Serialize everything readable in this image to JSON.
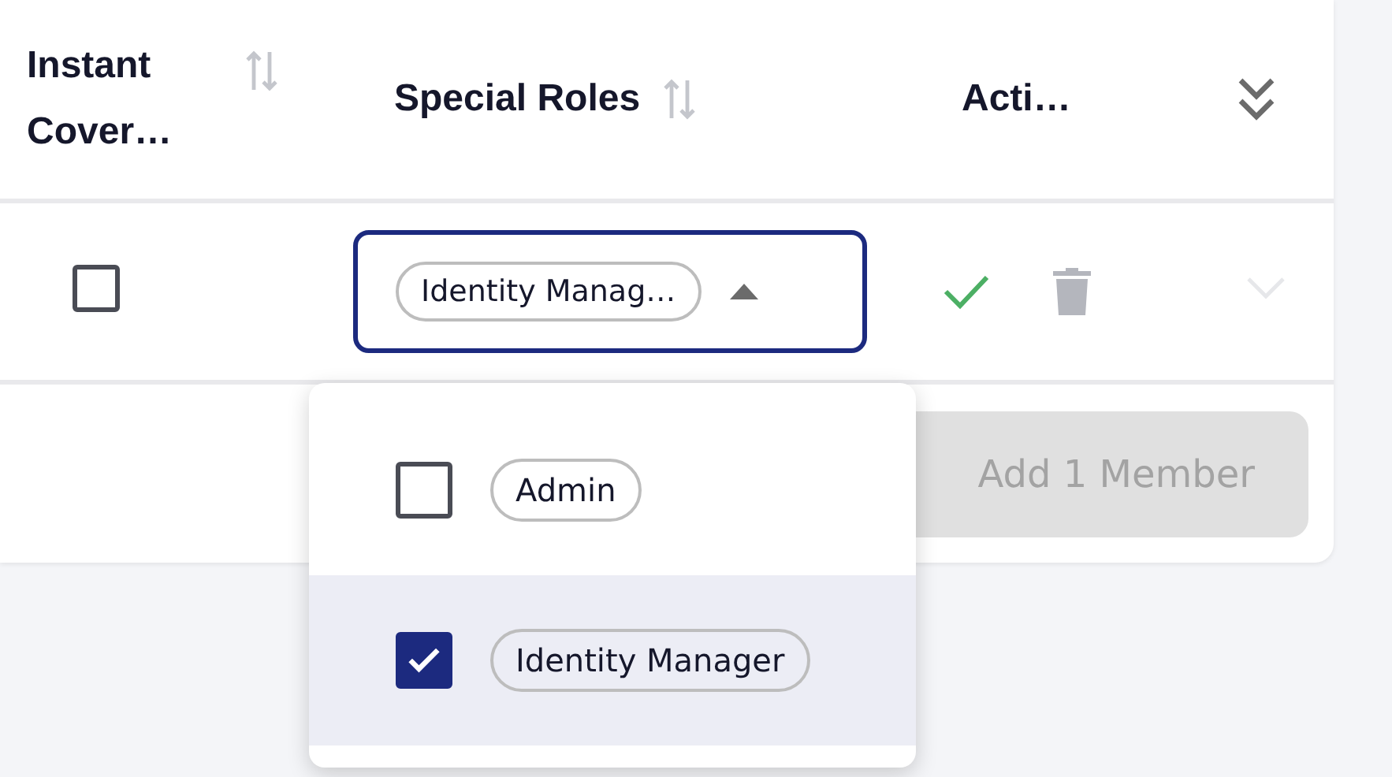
{
  "table": {
    "columns": [
      {
        "label": "Instant Cover…",
        "sortable": true
      },
      {
        "label": "Special Roles",
        "sortable": true
      },
      {
        "label": "Acti…",
        "sortable": false
      }
    ],
    "rows": [
      {
        "checked": false,
        "special_roles": [
          "Identity Manag…"
        ],
        "dropdown_open": true
      }
    ]
  },
  "roles_dropdown": {
    "options": [
      {
        "label": "Admin",
        "checked": false
      },
      {
        "label": "Identity Manager",
        "checked": true
      }
    ]
  },
  "add_button": {
    "label": "Add 1 Member",
    "disabled": true
  }
}
